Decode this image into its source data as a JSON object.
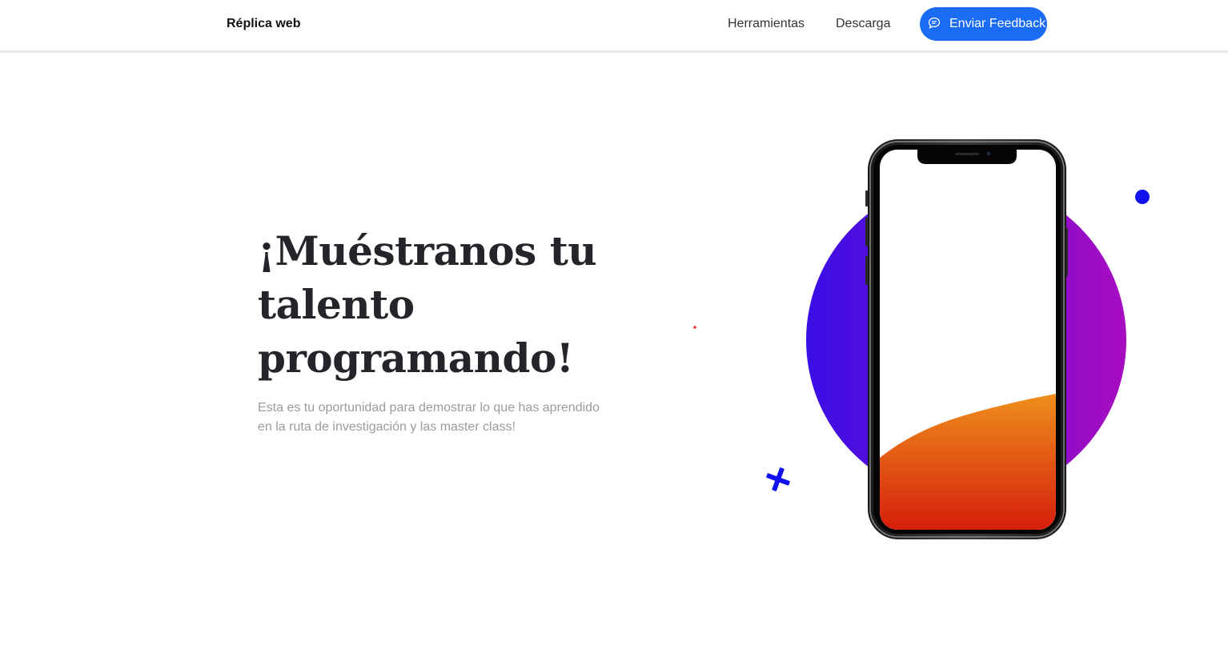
{
  "navbar": {
    "brand": "Réplica web",
    "links": {
      "tools": "Herramientas",
      "download": "Descarga"
    },
    "feedback_button": {
      "label": "Enviar Feedback",
      "icon": "chat-bubble-icon"
    }
  },
  "hero": {
    "title": "¡Muéstranos tu talento programando!",
    "subtitle": "Esta es tu oportunidad para demostrar lo que has aprendido en la ruta de investigación y las master class!"
  },
  "colors": {
    "accent_blue": "#1a6cf4",
    "circle_gradient_start": "#3a0ee6",
    "circle_gradient_end": "#a80cc0",
    "dot_blue": "#1111ee",
    "cross_blue": "#1111ee",
    "small_dot_red": "#e0362a",
    "phone_wave_top": "#ee8f1c",
    "phone_wave_bottom": "#d61e0c"
  }
}
